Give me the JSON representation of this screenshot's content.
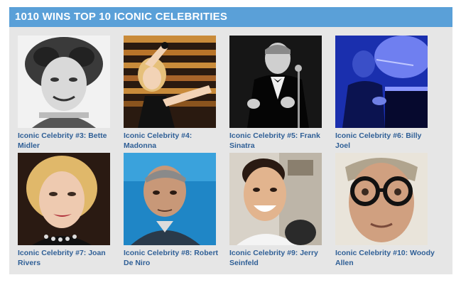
{
  "header": {
    "title": "1010 WINS TOP 10 ICONIC CELEBRITIES"
  },
  "colors": {
    "header_bg": "#5aa0d8",
    "panel_bg": "#e6e6e6",
    "link": "#2f5f96"
  },
  "celebrities": [
    {
      "caption": "Iconic Celebrity #3: Bette Midler"
    },
    {
      "caption": "Iconic Celebrity #4: Madonna"
    },
    {
      "caption": "Iconic Celebrity #5: Frank Sinatra"
    },
    {
      "caption": "Iconic Celebrity #6: Billy Joel"
    },
    {
      "caption": "Iconic Celebrity #7: Joan Rivers"
    },
    {
      "caption": "Iconic Celebrity #8: Robert De Niro"
    },
    {
      "caption": "Iconic Celebrity #9: Jerry Seinfeld"
    },
    {
      "caption": "Iconic Celebrity #10: Woody Allen"
    }
  ]
}
